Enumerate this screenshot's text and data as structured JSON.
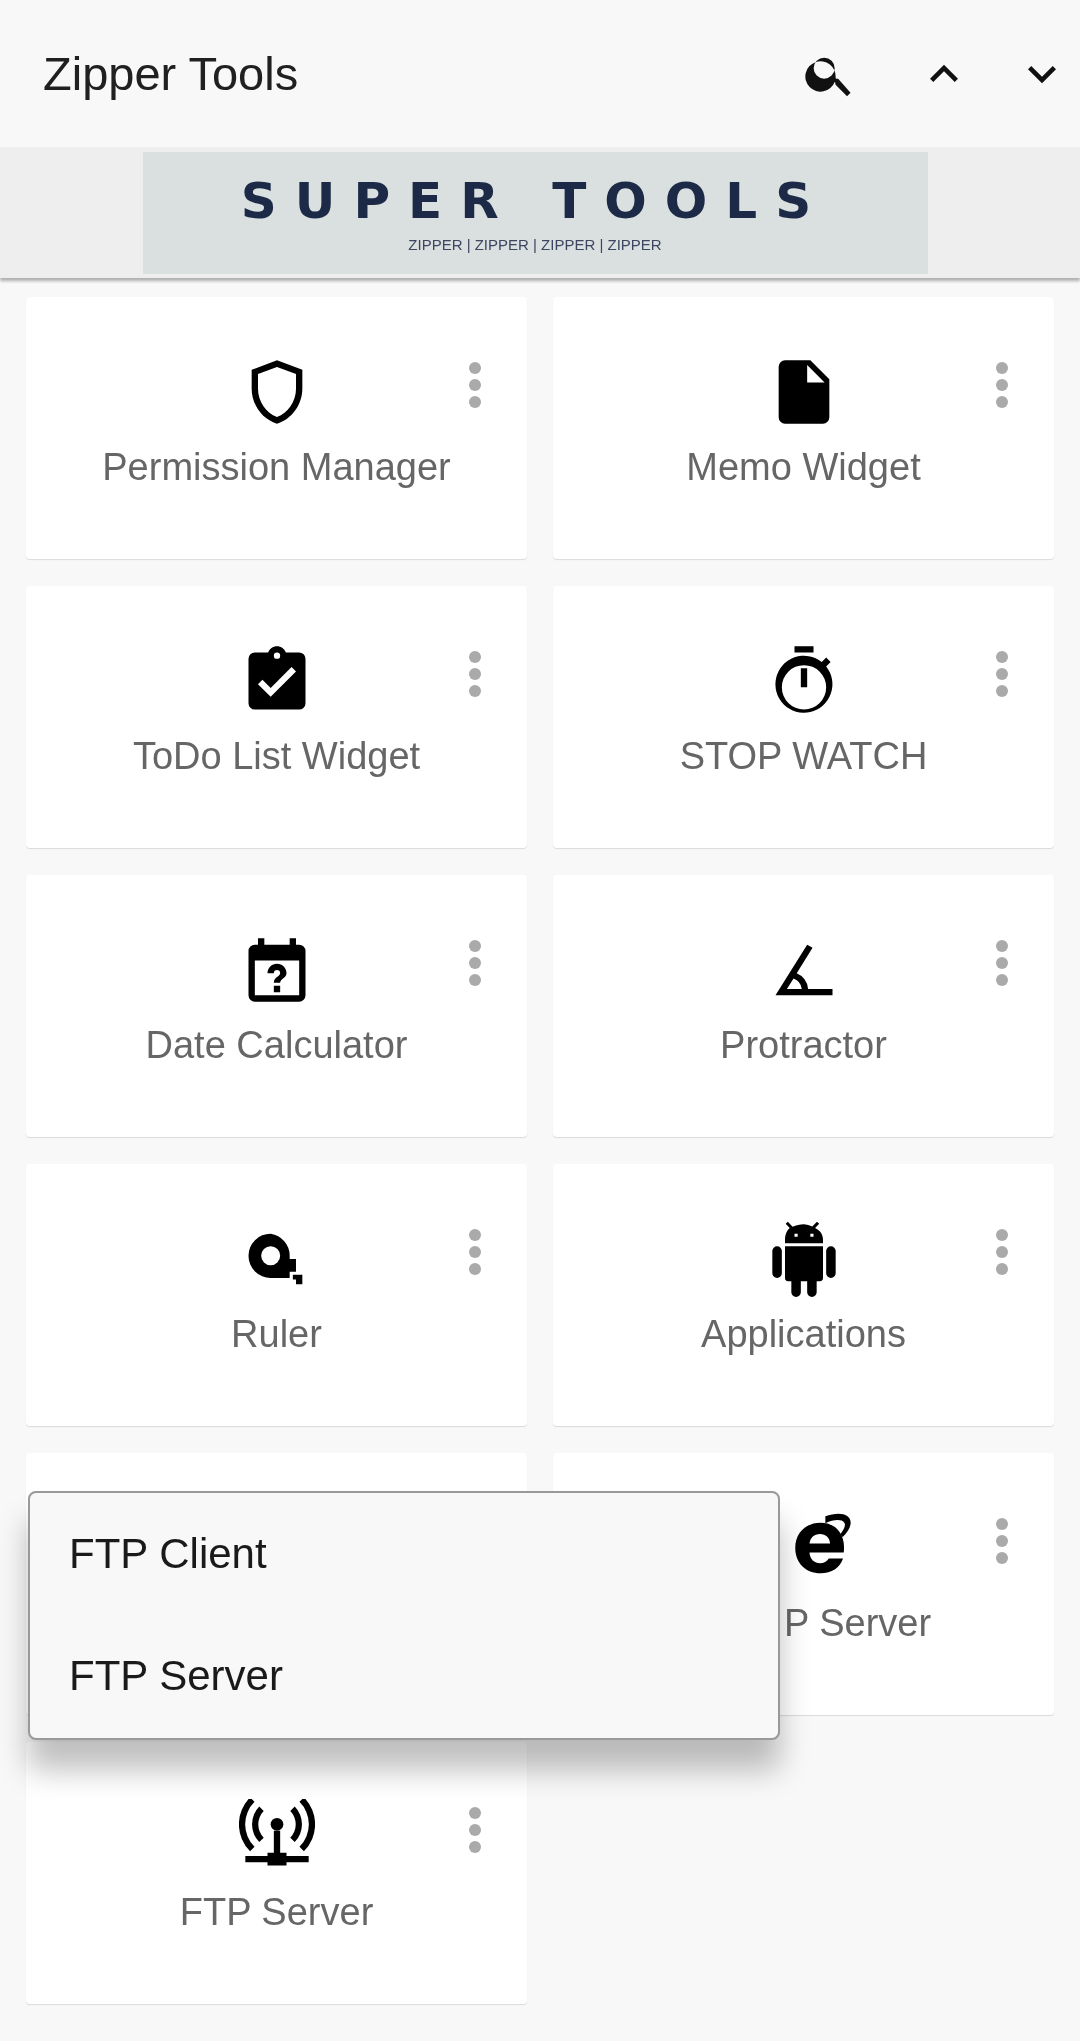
{
  "app_bar": {
    "title": "Zipper Tools"
  },
  "banner": {
    "title": "SUPER TOOLS",
    "subtitle": "ZIPPER | ZIPPER | ZIPPER | ZIPPER"
  },
  "cards": [
    {
      "kind": "tool",
      "label": "Permission Manager"
    },
    {
      "kind": "tool",
      "label": "Memo Widget"
    },
    {
      "kind": "tool",
      "label": "ToDo List Widget"
    },
    {
      "kind": "tool",
      "label": "STOP WATCH"
    },
    {
      "kind": "tool",
      "label": "Date Calculator"
    },
    {
      "kind": "tool",
      "label": "Protractor"
    },
    {
      "kind": "tool",
      "label": "Ruler"
    },
    {
      "kind": "tool",
      "label": "Applications"
    },
    {
      "kind": "covered"
    },
    {
      "kind": "partial",
      "label": "P Server"
    },
    {
      "kind": "tool",
      "label": "FTP Server"
    }
  ],
  "popup_menu": {
    "items": [
      "FTP Client",
      "FTP Server"
    ]
  }
}
